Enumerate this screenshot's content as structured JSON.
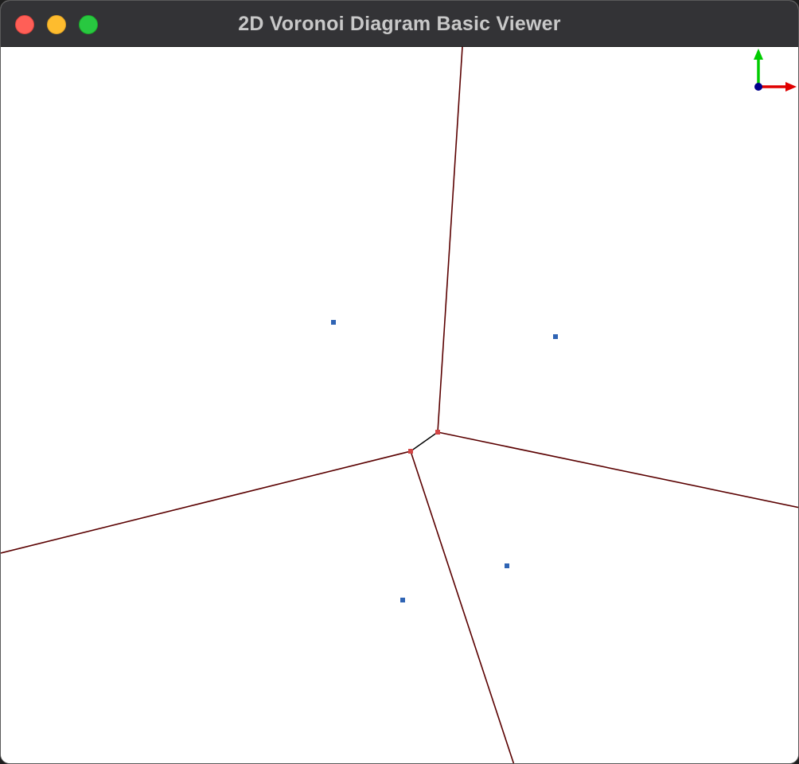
{
  "window": {
    "title": "2D Voronoi Diagram Basic Viewer"
  },
  "controls": {
    "close": "close-button",
    "minimize": "minimize-button",
    "zoom": "zoom-button"
  },
  "colors": {
    "titlebar": "#333336",
    "title_text": "#c8c8c8",
    "canvas": "#ffffff",
    "site": "#2f64b4",
    "vertex": "#d24646",
    "edge": "#5a0000",
    "short_edge": "#000000",
    "axis_x": "#e00000",
    "axis_y": "#00cc00",
    "axis_origin": "#00008b"
  },
  "diagram": {
    "site_count": 4,
    "vertex_count": 2,
    "edge_count": 5
  },
  "axis_gizmo": {
    "icon": "xy-axis-icon"
  }
}
